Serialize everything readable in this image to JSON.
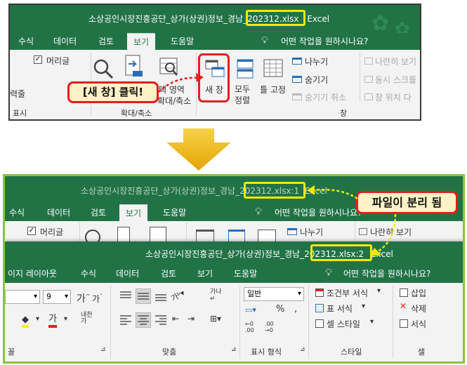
{
  "top": {
    "title": "소상공인시장진흥공단_상가(상권)정보_경남_202312.xlsx",
    "app": "Excel",
    "tabs": [
      "수식",
      "데이터",
      "검토",
      "보기",
      "도움말"
    ],
    "tell_me": "어떤 작업을 원하시나요?",
    "ribbon": {
      "gridlines_label": "머리글",
      "gridlines_checked": true,
      "left_label_partial": "력줄",
      "show_group": "표시",
      "zoom_group": "확대/축소",
      "zoom_select_label": "택 영역",
      "zoom_select_label2": "확대/축소",
      "new_window": "새 창",
      "arrange_all": "모두 정렬",
      "freeze_panes": "틀 고정",
      "split": "나누기",
      "hide": "숨기기",
      "unhide": "숨기기 취소",
      "view_side_by_side": "나란히 보기",
      "sync_scroll": "동시 스크롤",
      "reset_pos": "창 위치 다",
      "window_group": "창"
    },
    "callout": "[새 창] 클릭!"
  },
  "bottom": {
    "back": {
      "title": "소상공인시장진흥공단_상가(상권)정보_경남_202312.xlsx:1",
      "title_file": "202312.xlsx:1",
      "app": "Excel",
      "tabs": [
        "수식",
        "데이터",
        "검토",
        "보기",
        "도움말"
      ],
      "tell_me": "어떤 작업을 원하시나요?",
      "gridlines_label": "머리글",
      "split": "나누기",
      "view_side_by_side": "나란히 보기"
    },
    "front": {
      "title": "소상공인시장진흥공단_상가(상권)정보_경남_202312.xlsx:2",
      "app": "Excel",
      "tabs": [
        "이지 레이아웃",
        "수식",
        "데이터",
        "검토",
        "보기",
        "도움말"
      ],
      "tell_me": "어떤 작업을 원하시나요?",
      "font_size": "9",
      "number_format": "일반",
      "conditional_format": "조건부 서식",
      "table_format": "표 서식",
      "cell_style": "셀 스타일",
      "insert": "삽입",
      "delete": "삭제",
      "format": "서식",
      "group_font_partial": "꼴",
      "group_alignment": "맞춤",
      "group_number": "표시 형식",
      "group_styles": "스타일",
      "group_cells_partial": "셀"
    },
    "callout": "파일이 분리 됨"
  },
  "colors": {
    "excel_green": "#217346",
    "frame_green": "#8ac43f",
    "highlight_yellow": "#f2ea00",
    "callout_red": "#e41e1e",
    "arrow_gold": "#f2b600"
  }
}
